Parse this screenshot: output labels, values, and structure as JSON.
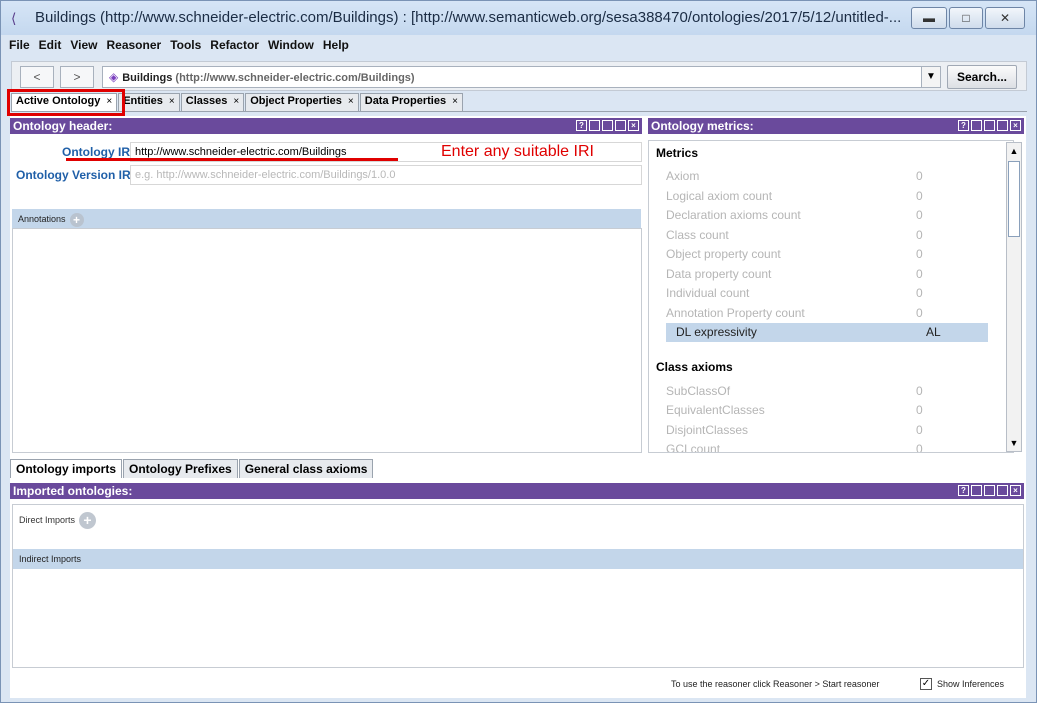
{
  "window": {
    "title": "Buildings (http://www.schneider-electric.com/Buildings) : [http://www.semanticweb.org/sesa388470/ontologies/2017/5/12/untitled-..."
  },
  "menu": [
    "File",
    "Edit",
    "View",
    "Reasoner",
    "Tools",
    "Refactor",
    "Window",
    "Help"
  ],
  "nav": {
    "back": "<",
    "forward": ">",
    "entity_name": "Buildings",
    "entity_iri": "(http://www.schneider-electric.com/Buildings)",
    "dropdown_icon": "chevron-down-icon",
    "search_label": "Search..."
  },
  "tabs": [
    "Active Ontology",
    "Entities",
    "Classes",
    "Object Properties",
    "Data Properties"
  ],
  "header_panel": {
    "title": "Ontology header:",
    "iri_label": "Ontology IRI",
    "iri_value": "http://www.schneider-electric.com/Buildings",
    "version_label": "Ontology Version IRI",
    "version_placeholder": "e.g. http://www.schneider-electric.com/Buildings/1.0.0",
    "annotations_label": "Annotations",
    "annotation_note": "Enter any suitable IRI"
  },
  "metrics_panel": {
    "title": "Ontology metrics:",
    "metrics_heading": "Metrics",
    "metrics": [
      {
        "name": "Axiom",
        "value": "0"
      },
      {
        "name": "Logical axiom count",
        "value": "0"
      },
      {
        "name": "Declaration axioms count",
        "value": "0"
      },
      {
        "name": "Class count",
        "value": "0"
      },
      {
        "name": "Object property count",
        "value": "0"
      },
      {
        "name": "Data property count",
        "value": "0"
      },
      {
        "name": "Individual count",
        "value": "0"
      },
      {
        "name": "Annotation Property count",
        "value": "0"
      },
      {
        "name": "DL expressivity",
        "value": "AL"
      }
    ],
    "class_axioms_heading": "Class axioms",
    "class_axioms": [
      {
        "name": "SubClassOf",
        "value": "0"
      },
      {
        "name": "EquivalentClasses",
        "value": "0"
      },
      {
        "name": "DisjointClasses",
        "value": "0"
      },
      {
        "name": "GCI count",
        "value": "0"
      }
    ]
  },
  "bottom_tabs": [
    "Ontology imports",
    "Ontology Prefixes",
    "General class axioms"
  ],
  "imports_panel": {
    "title": "Imported ontologies:",
    "direct_label": "Direct Imports",
    "indirect_label": "Indirect Imports"
  },
  "status": {
    "reasoner_hint": "To use the reasoner click Reasoner > Start reasoner",
    "show_inferences": "Show Inferences",
    "show_inferences_checked": true
  }
}
